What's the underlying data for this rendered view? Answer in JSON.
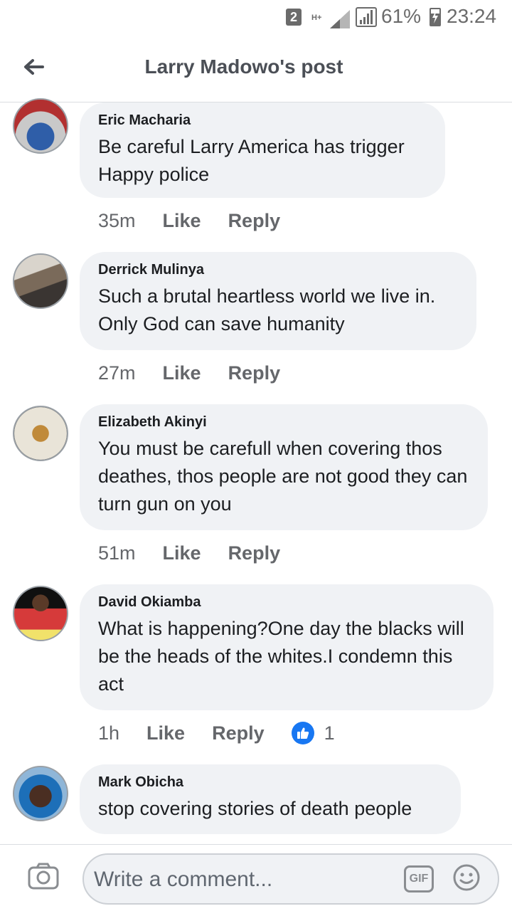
{
  "status_bar": {
    "sim": "2",
    "network": "H+",
    "battery_pct": "61%",
    "time": "23:24"
  },
  "header": {
    "title": "Larry Madowo's post"
  },
  "comments": [
    {
      "author": "Eric Macharia",
      "text": "Be careful Larry America has trigger Happy police",
      "time": "35m",
      "like_label": "Like",
      "reply_label": "Reply"
    },
    {
      "author": "Derrick Mulinya",
      "text": "Such a brutal heartless world we live in. Only God can save humanity",
      "time": "27m",
      "like_label": "Like",
      "reply_label": "Reply"
    },
    {
      "author": "Elizabeth Akinyi",
      "text": "You must be carefull when covering thos deathes, thos people are not good they can turn gun on you",
      "time": "51m",
      "like_label": "Like",
      "reply_label": "Reply"
    },
    {
      "author": "David Okiamba",
      "text": "What is happening?One day the blacks will be the heads of the whites.I condemn this act",
      "time": "1h",
      "like_label": "Like",
      "reply_label": "Reply",
      "reaction_icon": "thumbs-up-icon",
      "reaction_count": "1"
    },
    {
      "author": "Mark Obicha",
      "text": "stop covering stories of death people"
    }
  ],
  "composer": {
    "placeholder": "Write a comment...",
    "gif_label": "GIF"
  },
  "colors": {
    "bubble": "#f0f2f5",
    "meta_text": "#65676b",
    "reaction_blue": "#1877f2"
  }
}
